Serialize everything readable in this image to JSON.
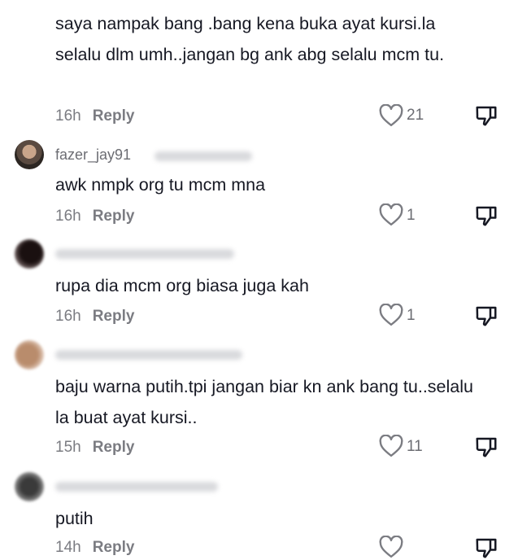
{
  "comments": [
    {
      "text": "saya nampak bang .bang kena buka ayat kursi.la selalu dlm umh..jangan bg ank abg selalu mcm tu.",
      "time": "16h",
      "reply": "Reply",
      "likes": "21",
      "like_icon": "heart-outline-icon",
      "dislike_icon": "thumbs-down-icon"
    },
    {
      "username": "fazer_jay91",
      "username_blurred": true,
      "text": "awk nmpk org tu mcm mna",
      "time": "16h",
      "reply": "Reply",
      "likes": "1"
    },
    {
      "username_blurred": true,
      "text": "rupa dia mcm org biasa juga kah",
      "time": "16h",
      "reply": "Reply",
      "likes": "1"
    },
    {
      "username_blurred": true,
      "text": "baju warna putih.tpi jangan biar kn ank bang tu..selalu la buat ayat kursi..",
      "time": "15h",
      "reply": "Reply",
      "likes": "11"
    },
    {
      "username_blurred": true,
      "text": "putih",
      "time": "14h",
      "reply": "Reply",
      "likes": ""
    }
  ]
}
